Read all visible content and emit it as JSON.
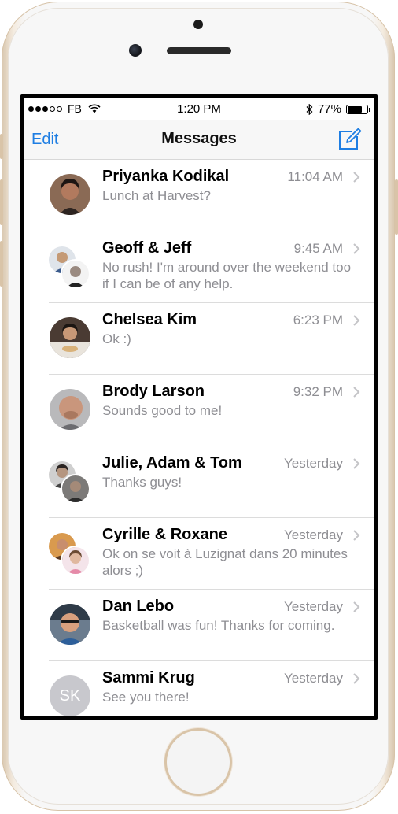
{
  "status_bar": {
    "carrier": "FB",
    "time": "1:20 PM",
    "battery": "77%",
    "battery_level": 0.77,
    "signal_bars_filled": 3,
    "signal_bars_total": 5
  },
  "nav": {
    "edit_label": "Edit",
    "title": "Messages",
    "compose_icon": "compose-icon"
  },
  "colors": {
    "accent": "#1e7ee3",
    "secondary_text": "#8e8e93",
    "initials_avatar": "#c8c8cd"
  },
  "conversations": [
    {
      "name": "Priyanka Kodikal",
      "time": "11:04 AM",
      "preview": "Lunch at Harvest?"
    },
    {
      "name": "Geoff & Jeff",
      "time": "9:45 AM",
      "preview": "No rush! I'm around over the weekend too if I can be of any help."
    },
    {
      "name": "Chelsea Kim",
      "time": "6:23 PM",
      "preview": "Ok :)"
    },
    {
      "name": "Brody Larson",
      "time": "9:32 PM",
      "preview": "Sounds good to me!"
    },
    {
      "name": "Julie, Adam & Tom",
      "time": "Yesterday",
      "preview": "Thanks guys!"
    },
    {
      "name": "Cyrille & Roxane",
      "time": "Yesterday",
      "preview": "Ok on se voit à Luzignat dans 20 minutes alors ;)"
    },
    {
      "name": "Dan Lebo",
      "time": "Yesterday",
      "preview": "Basketball was fun! Thanks for coming."
    },
    {
      "name": "Sammi Krug",
      "time": "Yesterday",
      "preview": "See you there!",
      "initials": "SK"
    }
  ]
}
